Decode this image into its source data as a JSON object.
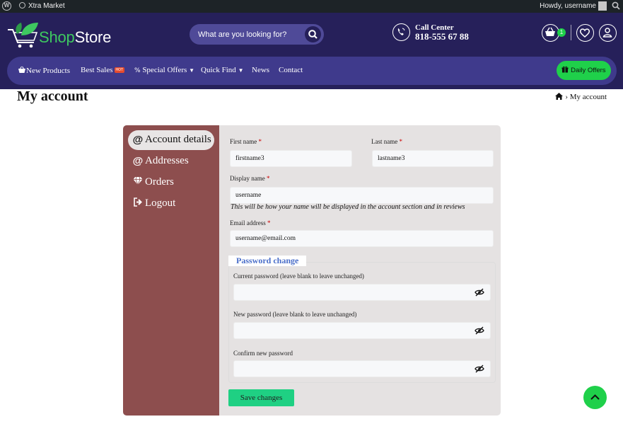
{
  "adminbar": {
    "site_name": "Xtra Market",
    "greeting": "Howdy, username"
  },
  "header": {
    "logo_text_a": "Shop",
    "logo_text_b": "Store",
    "search_placeholder": "What are you looking for?",
    "call_label": "Call Center",
    "call_number": "818-555 67 88",
    "cart_count": "1"
  },
  "nav": {
    "items": [
      "New Products",
      "Best Sales",
      "Special Offers",
      "Quick Find",
      "News",
      "Contact"
    ],
    "hot_badge": "HOT",
    "daily_offers": "Daily Offers"
  },
  "page": {
    "title": "My account",
    "breadcrumb": "My account"
  },
  "sidebar": {
    "items": [
      {
        "label": "Account details",
        "icon": "at-icon",
        "active": true
      },
      {
        "label": "Addresses",
        "icon": "at-icon",
        "active": false
      },
      {
        "label": "Orders",
        "icon": "diamond-icon",
        "active": false
      },
      {
        "label": "Logout",
        "icon": "logout-icon",
        "active": false
      }
    ]
  },
  "form": {
    "first_name_label": "First name",
    "first_name_value": "firstname3",
    "last_name_label": "Last name",
    "last_name_value": "lastname3",
    "display_name_label": "Display name",
    "display_name_value": "username",
    "display_name_hint": "This will be how your name will be displayed in the account section and in reviews",
    "email_label": "Email address",
    "email_value": "username@email.com",
    "required_mark": "*",
    "password_legend": "Password change",
    "current_password_label": "Current password (leave blank to leave unchanged)",
    "new_password_label": "New password (leave blank to leave unchanged)",
    "confirm_password_label": "Confirm new password",
    "save_label": "Save changes"
  },
  "colors": {
    "header_bg": "#26205a",
    "nav_bg": "#3f3a8c",
    "accent_green": "#1fd04a",
    "sidebar_bg": "#8d4e4e",
    "legend_blue": "#4a6ec9"
  }
}
